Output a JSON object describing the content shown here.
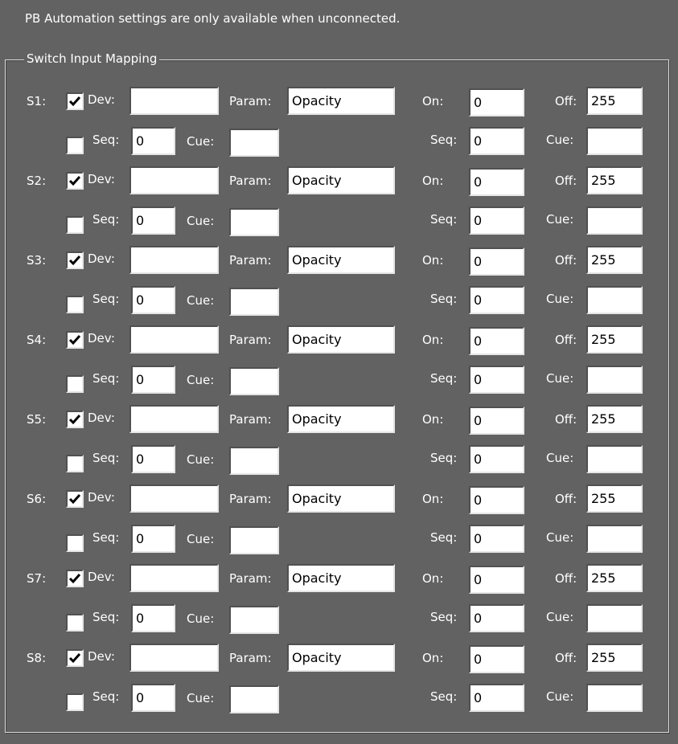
{
  "notice": "PB Automation settings are only available when unconnected.",
  "group_title": "Switch Input Mapping",
  "labels": {
    "dev": "Dev:",
    "param": "Param:",
    "on": "On:",
    "off": "Off:",
    "seq": "Seq:",
    "cue": "Cue:"
  },
  "rows": [
    {
      "name": "S1:",
      "dev_checked": true,
      "dev": "",
      "param": "Opacity",
      "on": "0",
      "off": "255",
      "seq_checked": false,
      "seq": "0",
      "cue": "",
      "seq2": "0",
      "cue2": ""
    },
    {
      "name": "S2:",
      "dev_checked": true,
      "dev": "",
      "param": "Opacity",
      "on": "0",
      "off": "255",
      "seq_checked": false,
      "seq": "0",
      "cue": "",
      "seq2": "0",
      "cue2": ""
    },
    {
      "name": "S3:",
      "dev_checked": true,
      "dev": "",
      "param": "Opacity",
      "on": "0",
      "off": "255",
      "seq_checked": false,
      "seq": "0",
      "cue": "",
      "seq2": "0",
      "cue2": ""
    },
    {
      "name": "S4:",
      "dev_checked": true,
      "dev": "",
      "param": "Opacity",
      "on": "0",
      "off": "255",
      "seq_checked": false,
      "seq": "0",
      "cue": "",
      "seq2": "0",
      "cue2": ""
    },
    {
      "name": "S5:",
      "dev_checked": true,
      "dev": "",
      "param": "Opacity",
      "on": "0",
      "off": "255",
      "seq_checked": false,
      "seq": "0",
      "cue": "",
      "seq2": "0",
      "cue2": ""
    },
    {
      "name": "S6:",
      "dev_checked": true,
      "dev": "",
      "param": "Opacity",
      "on": "0",
      "off": "255",
      "seq_checked": false,
      "seq": "0",
      "cue": "",
      "seq2": "0",
      "cue2": ""
    },
    {
      "name": "S7:",
      "dev_checked": true,
      "dev": "",
      "param": "Opacity",
      "on": "0",
      "off": "255",
      "seq_checked": false,
      "seq": "0",
      "cue": "",
      "seq2": "0",
      "cue2": ""
    },
    {
      "name": "S8:",
      "dev_checked": true,
      "dev": "",
      "param": "Opacity",
      "on": "0",
      "off": "255",
      "seq_checked": false,
      "seq": "0",
      "cue": "",
      "seq2": "0",
      "cue2": ""
    }
  ]
}
